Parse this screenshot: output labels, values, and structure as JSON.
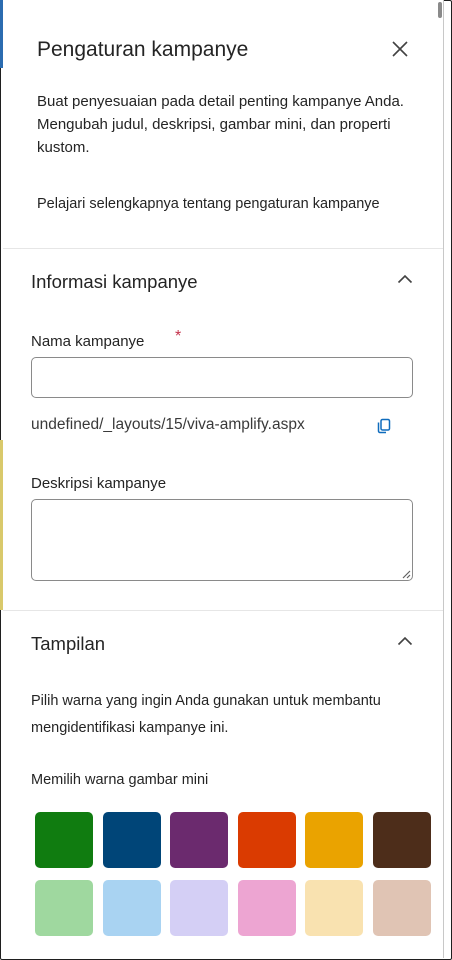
{
  "panel": {
    "title": "Pengaturan kampanye",
    "description": "Buat penyesuaian pada detail penting kampanye Anda. Mengubah judul, deskripsi, gambar mini, dan properti kustom.",
    "learn_more_link": "Pelajari selengkapnya tentang pengaturan kampanye",
    "close_icon": "close-icon"
  },
  "campaign_info": {
    "section_title": "Informasi kampanye",
    "name_label": "Nama kampanye",
    "required_marker": "*",
    "name_value": "",
    "url": "undefined/_layouts/15/viva-amplify.aspx",
    "copy_icon": "copy-icon",
    "description_label": "Deskripsi kampanye",
    "description_value": ""
  },
  "appearance": {
    "section_title": "Tampilan",
    "helper_text": "Pilih warna yang ingin Anda gunakan untuk membantu mengidentifikasi kampanye ini.",
    "thumbnail_color_label": "Memilih warna gambar mini",
    "colors": [
      "#107c10",
      "#004578",
      "#6b2a6e",
      "#da3b01",
      "#eaa300",
      "#4d2d1a",
      "#9fd89f",
      "#a9d3f2",
      "#d4cff5",
      "#eda5d2",
      "#f9e2b0",
      "#e0c4b4"
    ]
  }
}
